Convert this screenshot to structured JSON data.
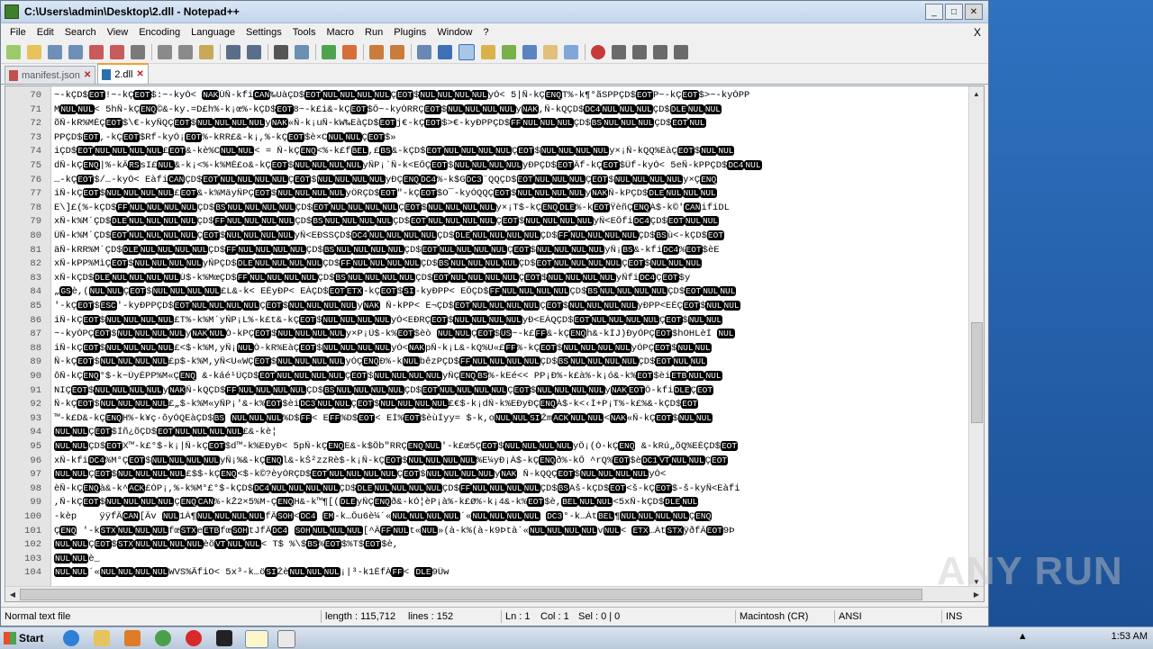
{
  "window": {
    "title": "C:\\Users\\admin\\Desktop\\2.dll - Notepad++"
  },
  "menu": [
    "File",
    "Edit",
    "Search",
    "View",
    "Encoding",
    "Language",
    "Settings",
    "Tools",
    "Macro",
    "Run",
    "Plugins",
    "Window",
    "?"
  ],
  "menu_close": "X",
  "tabs": [
    {
      "label": "manifest.json",
      "active": false
    },
    {
      "label": "2.dll",
      "active": true
    }
  ],
  "lines": [
    {
      "n": "70",
      "t": "~-kÇD$EOT!~-kÇEOT$:~-kyÓ< NAKÙÑ-kfiCAN‰UàÇD$EOTNULNULNULNULÇEOT$NULNULNULNULyÓ< 5|Ñ-kÇENQT%-k¶°ãSPPÇD$EOTP~-kÇEOT$>~-kyÓPP"
    },
    {
      "n": "71",
      "t": "MNULNUL< 5hÑ-kÇENQ©&-ky.=D£h%-k¡œ%-kÇD$EOT8~-k£i&-kÇEOT$Ô~-kyÓRRÇEOT$NULNULNULNULyNAK,Ñ-kQÇD$DC4NULNULNULÇD$DLENULNUL"
    },
    {
      "n": "72",
      "t": "õÑ-kR%MÈÇEOT$\\€-kyÑQÇEOT$NULNULNULNULyNAK«Ñ-k¡uÑ-kW‰EàÇD$EOTj€-kÇEOT$>€-kyÐPPÇD$FFNULNULNULÇD$BSNULNULNULÇD$EOTNUL"
    },
    {
      "n": "73",
      "t": "PPÇD$EOT,-kÇEOT$Rf-kyÓ¡EOT%-kRR£&-k¡,%-kÇEOT$è×CNULNULÇEOT$»"
    },
    {
      "n": "74",
      "t": "iÇD$EOTNULNULNULNUL£EOT&-kè%CNULNUL< = Ñ-kÇENQ<%-k£fBEL,£BS&-kÇD$EOTNULNULNULNULÇEOT$NULNULNULNULy×¡Ñ-kQQ%EàÇEOT$NULNUL"
    },
    {
      "n": "75",
      "t": "dÑ-kÇENQ|%-kÂRSsI£NUL&-k¡<%-k%MÈ£o&-kÇEOT$NULNULNULNULyÑP¡`Ñ-k<EÕÇEOT$NULNULNULNULyÐPÇD$EOTÂf-kÇEOT$Üf-kyÓ< 5eÑ-kPPÇD$DC4NUL"
    },
    {
      "n": "76",
      "t": "…-kÇEOT$/…-kyÓ< EàfiCANÇD$EOTNULNULNULNULÇEOT$NULNULNULNULyÐÇENQDC4%-k$GDC3¨QQÇD$EOTNULNULNULÇEOT$NULNULNULNULy×ÇENQ"
    },
    {
      "n": "77",
      "t": "iÑ-kÇEOT$NULNULNULNUL£EOT&-k%MäyÑPÇEOT$NULNULNULNULyÖRÇD$EOT\"-kÇEOT$O¯-kyÓQQÇEOT$NULNULNULNULyNAKÑ-kPÇD$DLENULNULNUL"
    },
    {
      "n": "78",
      "t": "E\\]£(%-kÇD$FFNULNULNULNULÇD$BSNULNULNULNULÇD$EOTNULNULNULNULÇEOT$NULNULNULNULy×¡T$-kÇENQDLE%-kEOTŸèñÇENQÀ$-k©'CANifiDL"
    },
    {
      "n": "79",
      "t": "xÑ-k%M´ÇD$DLENULNULNULNULÇD$FFNULNULNULNULÇD$BSNULNULNULNULÇD$EOTNULNULNULNULÇEOT$NULNULNULNULyÑ<EÕfiDC4ÇD$EOTNULNUL"
    },
    {
      "n": "80",
      "t": "ÜÑ-k%M´ÇD$EOTNULNULNULNULÇEOT$NULNULNULNULyÑ<EÐSSÇD$DC4NULNULNULNULÇD$DLENULNULNULNULÇD$FFNULNULNULNULÇD$BSù<-kÇD$EOT"
    },
    {
      "n": "81",
      "t": "äÑ-kRR%M´ÇD$DLENULNULNULNULÇD$FFNULNULNULNULÇD$BSNULNULNULNULÇD$EOTNULNULNULNULÇEOT$NULNULNULNULyÑ¡BS&-kfiDC4%EOT$èE"
    },
    {
      "n": "82",
      "t": "xÑ-kPP%MìÇEOT$NULNULNULNULyÑPÇD$DLENULNULNULNULÇD$FFNULNULNULNULÇD$BSNULNULNULNULÇD$EOTNULNULNULNULÇEOT$NULNULNUL"
    },
    {
      "n": "83",
      "t": "xÑ-kÇD$DLENULNULNULNULÙ$-k%MœÇD$FFNULNULNULNULÇD$BSNULNULNULNULÇD$EOTNULNULNULNULÇEOT$NULNULNULNULyÑfiDC4ÇEOT$y"
    },
    {
      "n": "84",
      "t": "„GSè,(NULNULÇEOT$NULNULNULNUL£L&-k< EÈyÐP< EÀÇD$EOTETX-kÇEOT$SI-kyÐPP< EÔÇD$FFNULNULNULNULÇD$BSNULNULNULNULÇD$EOTNULNUL"
    },
    {
      "n": "85",
      "t": "'-kÇEOT$ESC'-kyÐPPÇD$EOTNULNULNULNULÇEOT$NULNULNULNULyNAK Ñ-kPP< E¬ÇD$EOTNULNULNULNULÇEOT$NULNULNULNULyÐPP<EÈÇEOT$NULNUL"
    },
    {
      "n": "86",
      "t": "iÑ-kÇEOT$NULNULNULNUL£T%-k%M´yÑP¡L%-k£t&-kÇEOT$NULNULNULNULyÓ<EÐRÇEOT$NULNULNULNULyÐ<EÀQÇD$EOTNULNULNULNULÇEOT$NULNUL"
    },
    {
      "n": "87",
      "t": "~-kyÓPÇEOT$NULNULNULNULyNAKNULÒ-kPÇEOT$NULNULNULNULy×P¡Ü$-k%EOT$èò NULNULÇEOT$US~-k£FF&-kÇENQh&-kÍJ)ÐyÓPÇEOT$hOHLèÍ NUL"
    },
    {
      "n": "88",
      "t": "iÑ-kÇEOT$NULNULNULNUL£<$-k%M,yÑ¡NULÒ-kR%EàÇEOT$NULNULNULNULyÓ<NAKpÑ-k¡L&-kQ%U«£FF%-kÇEOT$NULNULNULNULyÓPÇEOT$NULNUL"
    },
    {
      "n": "89",
      "t": "Ñ-kÇEOT$NULNULNULNUL£p$-k%M,yÑ<U«WÇEOT$NULNULNULNULyÓÇENQÐ%-kNULbêzPÇD$FFNULNULNULNULÇD$BSNULNULNULNULÇD$EOTNULNUL"
    },
    {
      "n": "90",
      "t": "ôÑ-kÇENQ°$-k~ÙyÉPP%M«ÇENQ &-káé¹ÜÇD$EOTNULNULNULNULÇEOT$NULNULNULNULyÑÇENQBS%-kEé<< PP¡Ð%-k£à%-k¡ó&-k%EOT$èiETBNULNUL"
    },
    {
      "n": "91",
      "t": "NIÇEOT$NULNULNULNULyNAKÑ-kQÇD$FFNULNULNULNULÇD$BSNULNULNULNULÇD$EOTNULNULNULNULÇEOT$NULNULNULNULyNAKEOTÔ-kfiDLEÇEOT"
    },
    {
      "n": "92",
      "t": "Ñ-kÇEOT$NULNULNULNUL£„$-k%M«yÑP¡'&-k%EOT$èiDC3NULNULÇEOT$NULNULNULNUL£€$-k¡dÑ-k%EÐyÐÇENQÀ$-k<‹Ì+P¡T%-k£%&-kÇD$EOT"
    },
    {
      "n": "93",
      "t": "™-k£D&-kÇENQH%-k¥ç·ôyÓQEàÇD$BS NULNULNUL%D$FF< EFF%D$EOT< EÌ%EOT$èùÍyy= $-k,oNULNULSIŽmACKNULNUL<NAK«Ñ-kÇEOT$NULNUL"
    },
    {
      "n": "94",
      "t": "NULNULÇEOT$Íñ¿õÇD$EOTNULNULNULNUL£&-kè¦"
    },
    {
      "n": "95",
      "t": "NULNULÇD$EOTX™-k£°$-k¡|Ñ-kÇEOT$d™-k%EÐyÐ< 5pÑ-kÇENQE&-k$Ôb\"RRÇENQNUL'-k£œ5ÇEOT$NULNULNULNULyÔ¡(Ò-kÇENQ &-kRú„õQ%EÈÇD$EOT"
    },
    {
      "n": "96",
      "t": "xÑ-kfiDC4%M°ÇEOT$NULNULNULNULyÑ¡%&-kÇENQl&-kŠ²zzRè$-k¡Ñ-kÇEOT$NULNULNULNUL%E¼yÐ¡À$-kÇENQð%-kÕ ^rQ%EOT$èDC1VTNULNULÇEOT"
    },
    {
      "n": "97",
      "t": "NULNULÇEOT$NULNULNULNUL£$$-kÇENQ<$-k©?èyÓRÇD$EOTNULNULNULNULÇEOT$NULNULNULNULyNAK Ñ-kQQÇEOT$NULNULNULNULyÓ<"
    },
    {
      "n": "98",
      "t": "èÑ-kÇENQà&-k^ACK£ÓP¡,%-k%M°£°$-kÇD$DC4NULNULNULNULÇD$DLENULNULNULNULÇD$FFNULNULNULNULÇD$BSAš-kÇD$EOT<š-kÇEOT$-š-kyÑ<Eàfi"
    },
    {
      "n": "99",
      "t": ",Ñ-kÇEOT$NULNULNULNULÇENQCAN%-kŽ2×5%M-ÇENQH&-k™¶[(DLEyÑÇENQð&-kÓ¦èP¡à%-k£Ø%-k¡4&-k%EOT$è,BELNULNUL<5xÑ-kÇD$DLENUL"
    },
    {
      "n": "100",
      "t": "-kèp    ÿÿfÂCAN[Ãv NUL1À¶NULNULNULNULfÂSOH<DC4 EM-k…Ôu6è¼´«NULNULNULNUL´«NULNULNULNUL DC3°-k…ÀtBEL¶NULNULNULNULÇENQ"
    },
    {
      "n": "101",
      "t": "ÇENQ '-kSTXNULNULNULfœSTXeETBfœSOHtJfÂDC4 SOHNULNULNUL[^ÂFFNULt«NUL»(à-k%(à-k9Þtà´«NULNULNULNULvNUL< ETX…ÀtSTXÿðfÂEOT9Þ"
    },
    {
      "n": "102",
      "t": "NULNULÇEOT$STXNULNULNULNULèõVTNULNUL< T$ %\\$BS%EOT$%T$EOT$è,"
    },
    {
      "n": "103",
      "t": "NULNULè_"
    },
    {
      "n": "104",
      "t": "NULNUL´«NULNULNULNULWVS%ÃfiO< 5x³-k…öSIŽèNULNULNUL¡|³-k1ÉfÀFF< DLE9Üw"
    }
  ],
  "status": {
    "type": "Normal text file",
    "length": "length : 115,712",
    "lines": "lines : 152",
    "ln": "Ln : 1",
    "col": "Col : 1",
    "sel": "Sel : 0 | 0",
    "eol": "Macintosh (CR)",
    "encoding": "ANSI",
    "mode": "INS"
  },
  "taskbar": {
    "start": "Start",
    "time": "1:53 AM"
  },
  "watermark": "ANY RUN"
}
